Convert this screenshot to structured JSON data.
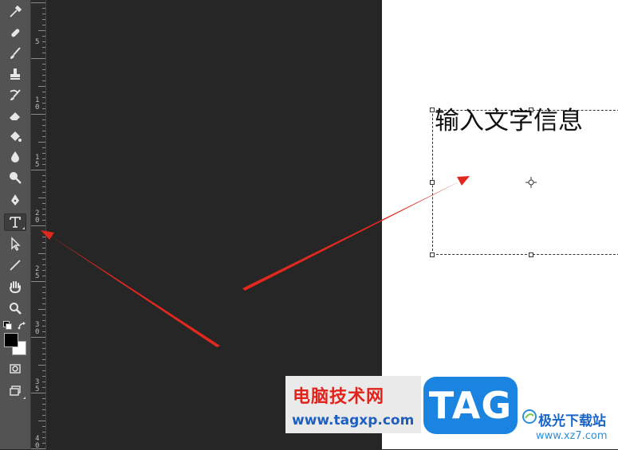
{
  "tools": [
    {
      "name": "eyedropper-icon",
      "active": false
    },
    {
      "name": "healing-brush-icon",
      "active": false
    },
    {
      "name": "brush-icon",
      "active": false
    },
    {
      "name": "clone-stamp-icon",
      "active": false
    },
    {
      "name": "history-brush-icon",
      "active": false
    },
    {
      "name": "eraser-icon",
      "active": false
    },
    {
      "name": "paint-bucket-icon",
      "active": false
    },
    {
      "name": "blur-drop-icon",
      "active": false
    },
    {
      "name": "dodge-icon",
      "active": false
    },
    {
      "name": "pen-icon",
      "active": false
    },
    {
      "name": "type-tool-icon",
      "active": true
    },
    {
      "name": "path-selection-icon",
      "active": false
    },
    {
      "name": "line-tool-icon",
      "active": false
    },
    {
      "name": "hand-tool-icon",
      "active": false
    },
    {
      "name": "zoom-tool-icon",
      "active": false
    }
  ],
  "ruler": {
    "labels": [
      "5",
      "1\n0",
      "1\n5",
      "2\n0",
      "2\n5",
      "3\n0",
      "3\n5",
      "4\n0"
    ]
  },
  "colors": {
    "foreground": "#000000",
    "background": "#ffffff",
    "arrow": "#e0281e"
  },
  "canvas": {
    "typed_text": "输入文字信息"
  },
  "watermark": {
    "site_cn": "电脑技术网",
    "site_url": "www.tagxp.com",
    "tag_label": "TAG",
    "xz_name": "极光下载站",
    "xz_url": "www.xz7.com"
  }
}
